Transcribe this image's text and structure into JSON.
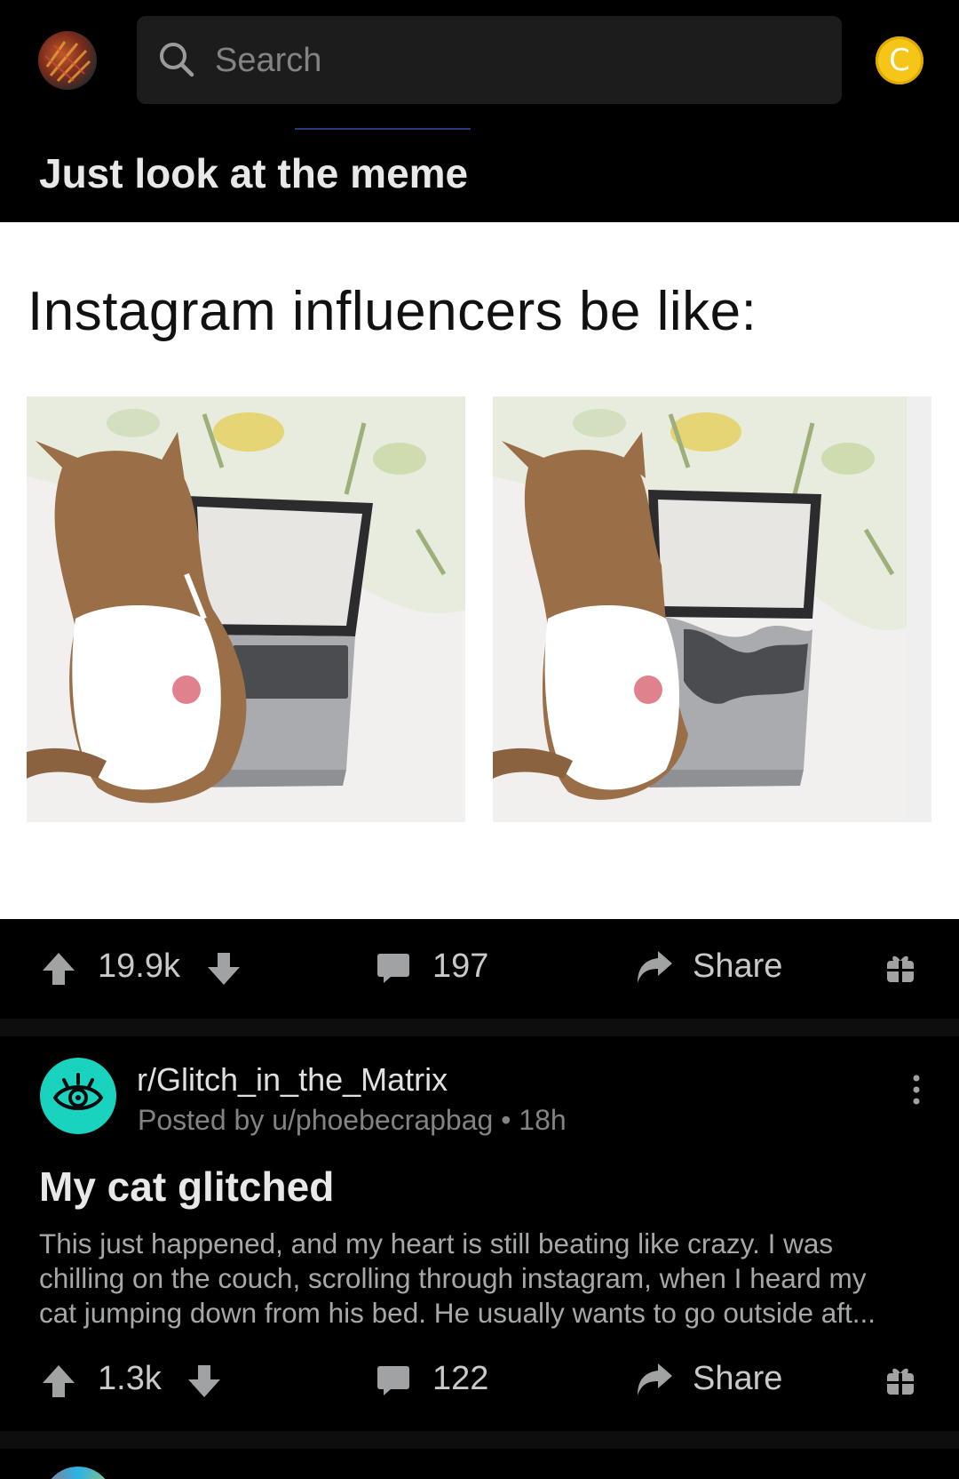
{
  "header": {
    "search_placeholder": "Search",
    "coin_symbol": "C",
    "accent_color": "#f5c518"
  },
  "post1": {
    "subtitle": "Just look at the meme",
    "meme_caption": "Instagram influencers be like:",
    "score": "19.9k",
    "comments": "197",
    "share_label": "Share"
  },
  "post2": {
    "subreddit": "r/Glitch_in_the_Matrix",
    "posted_by": "Posted by u/phoebecrapbag • 18h",
    "title": "My cat glitched",
    "body_lines": [
      "This just happened, and my heart is still beating like crazy.  I was",
      "chilling on the couch, scrolling through instagram, when I heard my",
      "cat jumping down from his bed. He usually wants to go outside aft..."
    ],
    "score": "1.3k",
    "comments": "122",
    "share_label": "Share",
    "icon_color": "#1ad3bf"
  }
}
